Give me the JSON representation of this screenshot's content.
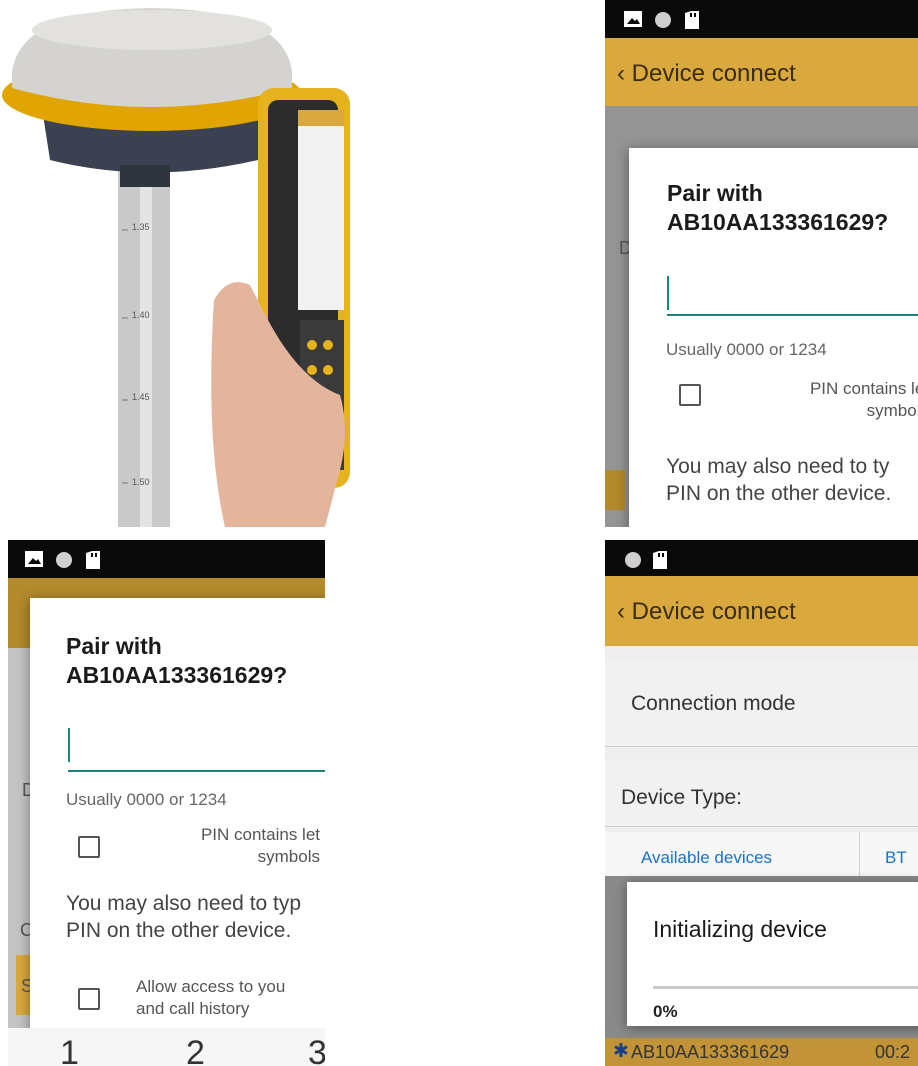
{
  "photo": {
    "scale_marks": [
      "1.35",
      "1.40",
      "1.45",
      "1.50"
    ],
    "colors": {
      "antenna_top": "#d4d3cf",
      "antenna_body": "#3b4150",
      "ring": "#e0a500",
      "controller": "#e6b21e",
      "pole": "#c9c9c9"
    }
  },
  "status_icons": [
    "image-icon",
    "record-icon",
    "sd-card-icon"
  ],
  "panel_tr": {
    "appbar_title": "Device connect",
    "dialog": {
      "title": "Pair with\nAB10AA133361629?",
      "hint": "Usually 0000 or 1234",
      "pin_checkbox_label": "PIN contains let\nsymbols",
      "note": "You may also need to ty\nPIN on the other device."
    },
    "background_fragments": [
      "D"
    ]
  },
  "panel_bl": {
    "dialog": {
      "title": "Pair with\nAB10AA133361629?",
      "hint": "Usually 0000 or 1234",
      "pin_checkbox_label": "PIN contains let\nsymbols",
      "note": "You may also need to typ\nPIN on the other device.",
      "access_checkbox_label": "Allow access to you\nand call history"
    },
    "keypad": [
      "1",
      "2",
      "3"
    ],
    "background_fragments": [
      "D",
      "C",
      "S"
    ]
  },
  "panel_br": {
    "appbar_title": "Device connect",
    "rows": {
      "connection_mode": "Connection mode",
      "device_type": "Device Type:",
      "tab_available": "Available devices",
      "tab_bt": "BT",
      "device_name": "AB10AA133361629",
      "device_addr": "00:2"
    },
    "dialog": {
      "title": "Initializing device",
      "progress_text": "0%",
      "progress": 0
    },
    "colors": {
      "accent": "#d9a93e",
      "teal": "#16877a"
    }
  }
}
